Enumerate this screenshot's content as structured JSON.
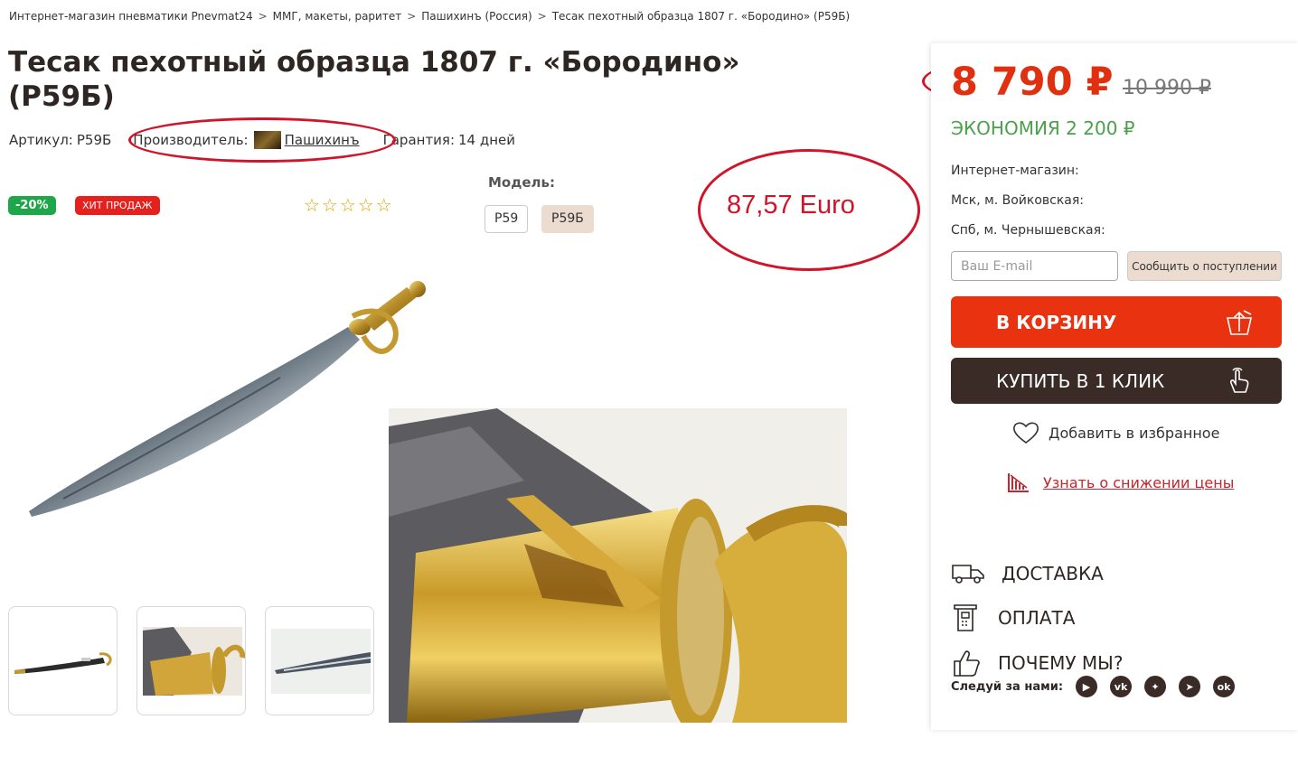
{
  "breadcrumbs": [
    "Интернет-магазин пневматики Pnevmat24",
    "ММГ, макеты, раритет",
    "Пашихинъ (Россия)",
    "Тесак пехотный образца 1807 г. «Бородино» (P59Б)"
  ],
  "product": {
    "title": "Тесак пехотный образца 1807 г. «Бородино» (P59Б)",
    "sku_label": "Артикул:",
    "sku": "P59Б",
    "maker_label": "Производитель:",
    "maker": "Пашихинъ",
    "warranty_label": "Гарантия:",
    "warranty": "14 дней",
    "rating": 0
  },
  "badges": {
    "discount": "-20%",
    "hit": "ХИТ ПРОДАЖ"
  },
  "stars": "☆☆☆☆☆",
  "model": {
    "label": "Модель:",
    "options": [
      "P59",
      "P59Б"
    ],
    "selected": "P59Б"
  },
  "annotation": {
    "euro": "87,57 Euro"
  },
  "side": {
    "price_new": "8 790 ₽",
    "price_old": "10 990 ₽",
    "saving": "ЭКОНОМИЯ 2 200 ₽",
    "stores": [
      "Интернет-магазин:",
      "Мск, м. Войковская:",
      "Спб, м. Чернышевская:"
    ],
    "email_placeholder": "Ваш E-mail",
    "notify_label": "Сообщить о поступлении",
    "cart_label": "В КОРЗИНУ",
    "oneclick_label": "КУПИТЬ В 1 КЛИК",
    "favorite_label": "Добавить в избранное",
    "price_watch_label": "Узнать о снижении цены",
    "delivery_label": "ДОСТАВКА",
    "payment_label": "ОПЛАТА",
    "why_label": "ПОЧЕМУ МЫ?",
    "follow_label": "Следуй за нами:"
  },
  "colors": {
    "accent": "#e83210",
    "dark": "#3a2b26",
    "saving": "#4aa14a",
    "annotation": "#d0142a"
  }
}
